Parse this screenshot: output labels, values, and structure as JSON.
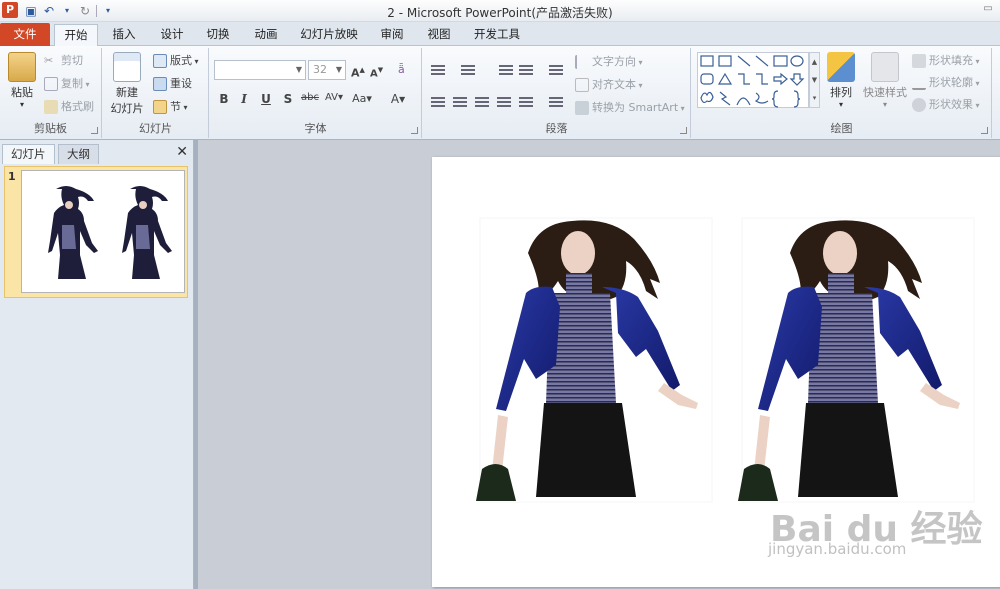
{
  "window": {
    "title": "2 - Microsoft PowerPoint(产品激活失败)"
  },
  "ribbon_tabs": [
    "文件",
    "开始",
    "插入",
    "设计",
    "切换",
    "动画",
    "幻灯片放映",
    "审阅",
    "视图",
    "开发工具"
  ],
  "clipboard": {
    "paste": "粘贴",
    "cut": "剪切",
    "copy": "复制",
    "format_painter": "格式刷",
    "label": "剪贴板"
  },
  "slides_group": {
    "new_slide_line1": "新建",
    "new_slide_line2": "幻灯片",
    "layout": "版式",
    "reset": "重设",
    "section": "节",
    "label": "幻灯片"
  },
  "font_group": {
    "font_name": "",
    "font_size": "32",
    "label": "字体"
  },
  "paragraph_group": {
    "text_direction": "文字方向",
    "align_text": "对齐文本",
    "smartart": "转换为 SmartArt",
    "label": "段落"
  },
  "drawing_group": {
    "arrange": "排列",
    "quick_styles": "快速样式",
    "shape_fill": "形状填充",
    "shape_outline": "形状轮廓",
    "shape_effects": "形状效果",
    "label": "绘图"
  },
  "left_panel": {
    "tab_slides": "幻灯片",
    "tab_outline": "大纲",
    "thumb_number": "1",
    "close": "✕"
  },
  "watermark": {
    "logo": "Bai du 经验",
    "url": "jingyan.baidu.com"
  },
  "colors": {
    "file_tab": "#d24726",
    "accent": "#2d5a9e",
    "thumb_highlight": "#fbe5a6"
  }
}
